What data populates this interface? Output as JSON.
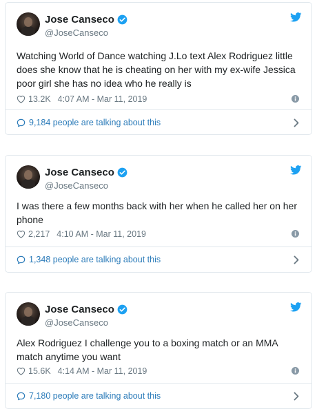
{
  "colors": {
    "text": "#1c2022",
    "secondary": "#697882",
    "link": "#2b7bb9",
    "twitter_blue": "#1da1f2",
    "border": "#e1e8ed"
  },
  "tweets": [
    {
      "name": "Jose Canseco",
      "handle": "@JoseCanseco",
      "text": "Watching World of Dance watching J.Lo text Alex Rodriguez little does she know that he is cheating on her with my ex-wife Jessica poor girl she has no idea who he really is",
      "likes": "13.2K",
      "time": "4:07 AM - Mar 11, 2019",
      "talking": "9,184 people are talking about this"
    },
    {
      "name": "Jose Canseco",
      "handle": "@JoseCanseco",
      "text": "I was there a few months back with her when he called her on her phone",
      "likes": "2,217",
      "time": "4:10 AM - Mar 11, 2019",
      "talking": "1,348 people are talking about this"
    },
    {
      "name": "Jose Canseco",
      "handle": "@JoseCanseco",
      "text": "Alex Rodriguez I challenge you to a boxing match or an MMA match anytime you want",
      "likes": "15.6K",
      "time": "4:14 AM - Mar 11, 2019",
      "talking": "7,180 people are talking about this"
    }
  ]
}
